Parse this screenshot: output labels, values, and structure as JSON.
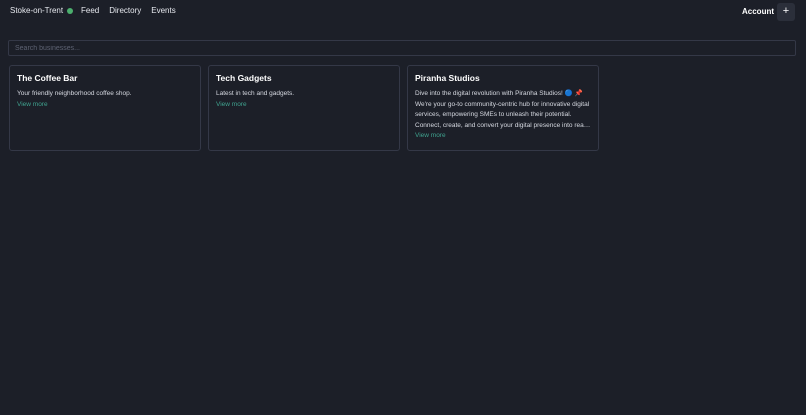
{
  "header": {
    "location": "Stoke-on-Trent",
    "status_color": "#4caf6e",
    "nav": [
      "Feed",
      "Directory",
      "Events"
    ],
    "account_label": "Account",
    "add_label": "+"
  },
  "search": {
    "placeholder": "Search businesses..."
  },
  "businesses": [
    {
      "name": "The Coffee Bar",
      "description": "Your friendly neighborhood coffee shop.",
      "link": "View more"
    },
    {
      "name": "Tech Gadgets",
      "description": "Latest in tech and gadgets.",
      "link": "View more"
    },
    {
      "name": "Piranha Studios",
      "description": "Dive into the digital revolution with Piranha Studios! 🔵 📌 We're your go-to community-centric hub for innovative digital services, empowering SMEs to unleash their potential. Connect, create, and convert your digital presence into real growth.",
      "link": "View more"
    }
  ],
  "colors": {
    "background": "#1c1f28",
    "border": "#343847",
    "link": "#3fa28e"
  }
}
